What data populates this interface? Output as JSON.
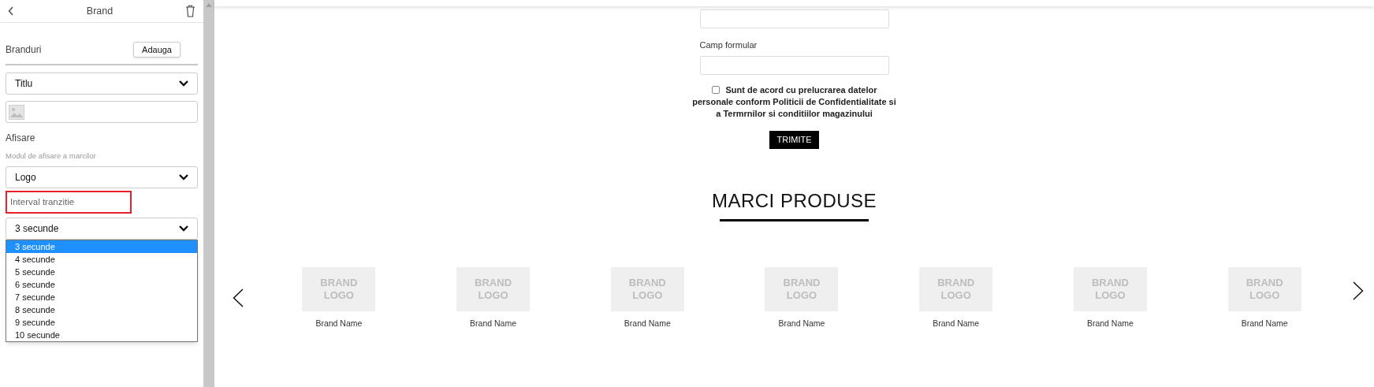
{
  "panel": {
    "title": "Brand",
    "brands_label": "Branduri",
    "add_button": "Adauga",
    "title_select": {
      "value": "Titlu"
    },
    "display": {
      "label": "Afisare",
      "hint": "Modul de afisare a marcilor",
      "value": "Logo"
    },
    "interval": {
      "label": "Interval tranzitie",
      "value": "3 secunde",
      "expanded": true,
      "options": [
        {
          "label": "3 secunde",
          "selected": true
        },
        {
          "label": "4 secunde",
          "selected": false
        },
        {
          "label": "5 secunde",
          "selected": false
        },
        {
          "label": "6 secunde",
          "selected": false
        },
        {
          "label": "7 secunde",
          "selected": false
        },
        {
          "label": "8 secunde",
          "selected": false
        },
        {
          "label": "9 secunde",
          "selected": false
        },
        {
          "label": "10 secunde",
          "selected": false
        }
      ]
    }
  },
  "form": {
    "fields": [
      {
        "kind": "input"
      },
      {
        "kind": "input",
        "label": "Camp formular"
      }
    ],
    "consent": {
      "checked": false,
      "text": "Sunt de acord cu prelucrarea datelor personale conform Politicii de Confidentialitate si a Termrnilor si conditiilor magazinului"
    },
    "submit": "TRIMITE"
  },
  "brands_section": {
    "title": "MARCI PRODUSE",
    "items": [
      {
        "logo": "BRAND LOGO",
        "name": "Brand Name"
      },
      {
        "logo": "BRAND LOGO",
        "name": "Brand Name"
      },
      {
        "logo": "BRAND LOGO",
        "name": "Brand Name"
      },
      {
        "logo": "BRAND LOGO",
        "name": "Brand Name"
      },
      {
        "logo": "BRAND LOGO",
        "name": "Brand Name"
      },
      {
        "logo": "BRAND LOGO",
        "name": "Brand Name"
      },
      {
        "logo": "BRAND LOGO",
        "name": "Brand Name"
      }
    ]
  }
}
